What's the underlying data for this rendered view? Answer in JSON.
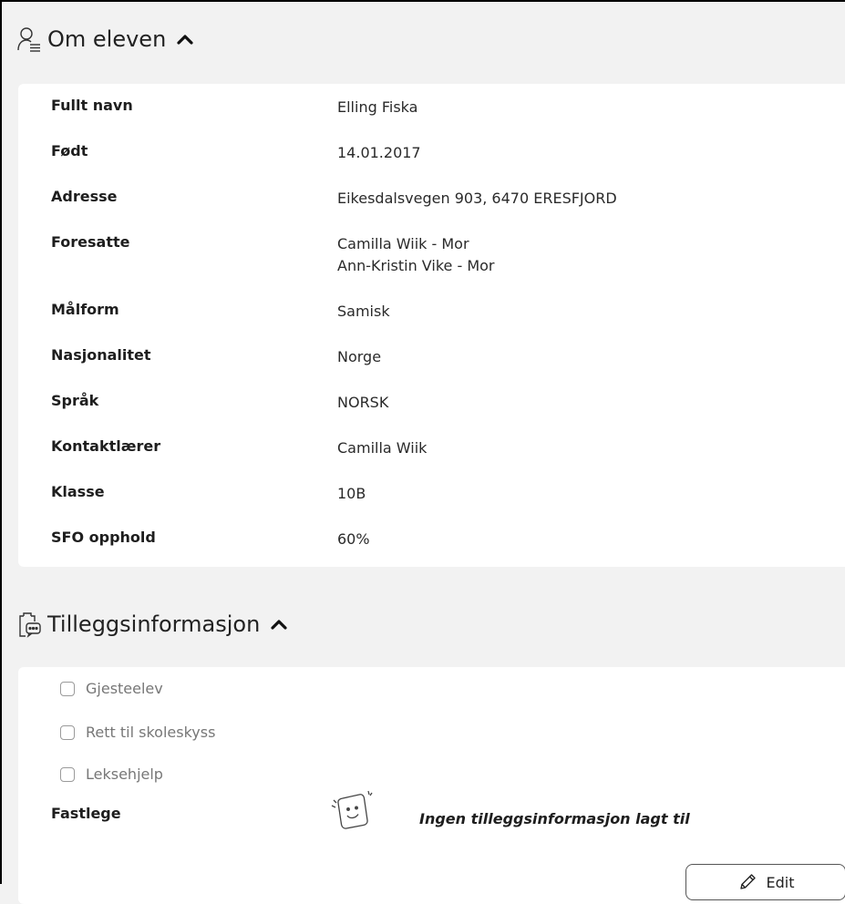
{
  "about": {
    "title": "Om eleven",
    "icon": "person-list-icon",
    "rows": [
      {
        "label": "Fullt navn",
        "values": [
          "Elling Fiska"
        ]
      },
      {
        "label": "Født",
        "values": [
          "14.01.2017"
        ]
      },
      {
        "label": "Adresse",
        "values": [
          "Eikesdalsvegen 903, 6470 ERESFJORD"
        ]
      },
      {
        "label": "Foresatte",
        "values": [
          "Camilla Wiik - Mor",
          "Ann-Kristin Vike - Mor"
        ]
      },
      {
        "label": "Målform",
        "values": [
          "Samisk"
        ]
      },
      {
        "label": "Nasjonalitet",
        "values": [
          "Norge"
        ]
      },
      {
        "label": "Språk",
        "values": [
          "NORSK"
        ]
      },
      {
        "label": "Kontaktlærer",
        "values": [
          "Camilla Wiik"
        ]
      },
      {
        "label": "Klasse",
        "values": [
          "10B"
        ]
      },
      {
        "label": "SFO opphold",
        "values": [
          "60%"
        ]
      }
    ]
  },
  "extra": {
    "title": "Tilleggsinformasjon",
    "icon": "clipboard-chat-icon",
    "checkboxes": [
      {
        "label": "Gjesteelev",
        "checked": false
      },
      {
        "label": "Rett til skoleskyss",
        "checked": false
      },
      {
        "label": "Leksehjelp",
        "checked": false
      }
    ],
    "fastlege_label": "Fastlege",
    "empty_text": "Ingen tilleggsinformasjon lagt til",
    "edit_label": "Edit"
  }
}
